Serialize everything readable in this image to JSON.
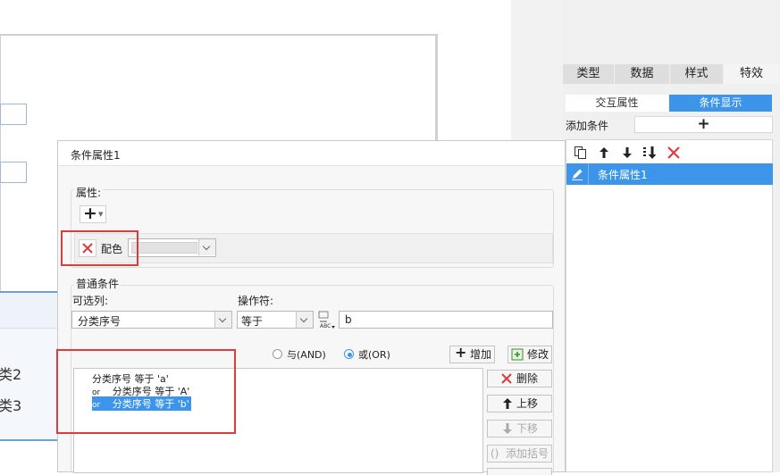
{
  "canvas": {
    "left_labels": [
      "类2",
      "类3"
    ]
  },
  "right_panel": {
    "tabs": [
      "类型",
      "数据",
      "样式",
      "特效"
    ],
    "subtabs": [
      "交互属性",
      "条件显示"
    ],
    "add_condition_label": "添加条件",
    "add_symbol": "+",
    "condition_items": [
      "条件属性1"
    ]
  },
  "dialog": {
    "title": "条件属性1",
    "attr_section_label": "属性:",
    "add_attr_symbol": "+",
    "color_label": "配色",
    "common_section_label": "普通条件",
    "optional_column_label": "可选列:",
    "optional_column_value": "分类序号",
    "operator_label": "操作符:",
    "operator_value": "等于",
    "value_input": "b",
    "and_label": "与(AND)",
    "or_label": "或(OR)",
    "add_button": "增加",
    "modify_button": "修改",
    "conditions": [
      {
        "prefix": "",
        "text": "分类序号 等于 'a'"
      },
      {
        "prefix": "or",
        "text": "分类序号 等于 'A'"
      },
      {
        "prefix": "or",
        "text": "分类序号 等于 'b'"
      }
    ],
    "delete_button": "删除",
    "up_button": "上移",
    "down_button": "下移",
    "add_paren_button": "添加括号"
  },
  "colors": {
    "accent": "#3c95e8",
    "highlight_border": "#e03a3a",
    "delete_red": "#e03a3a"
  }
}
